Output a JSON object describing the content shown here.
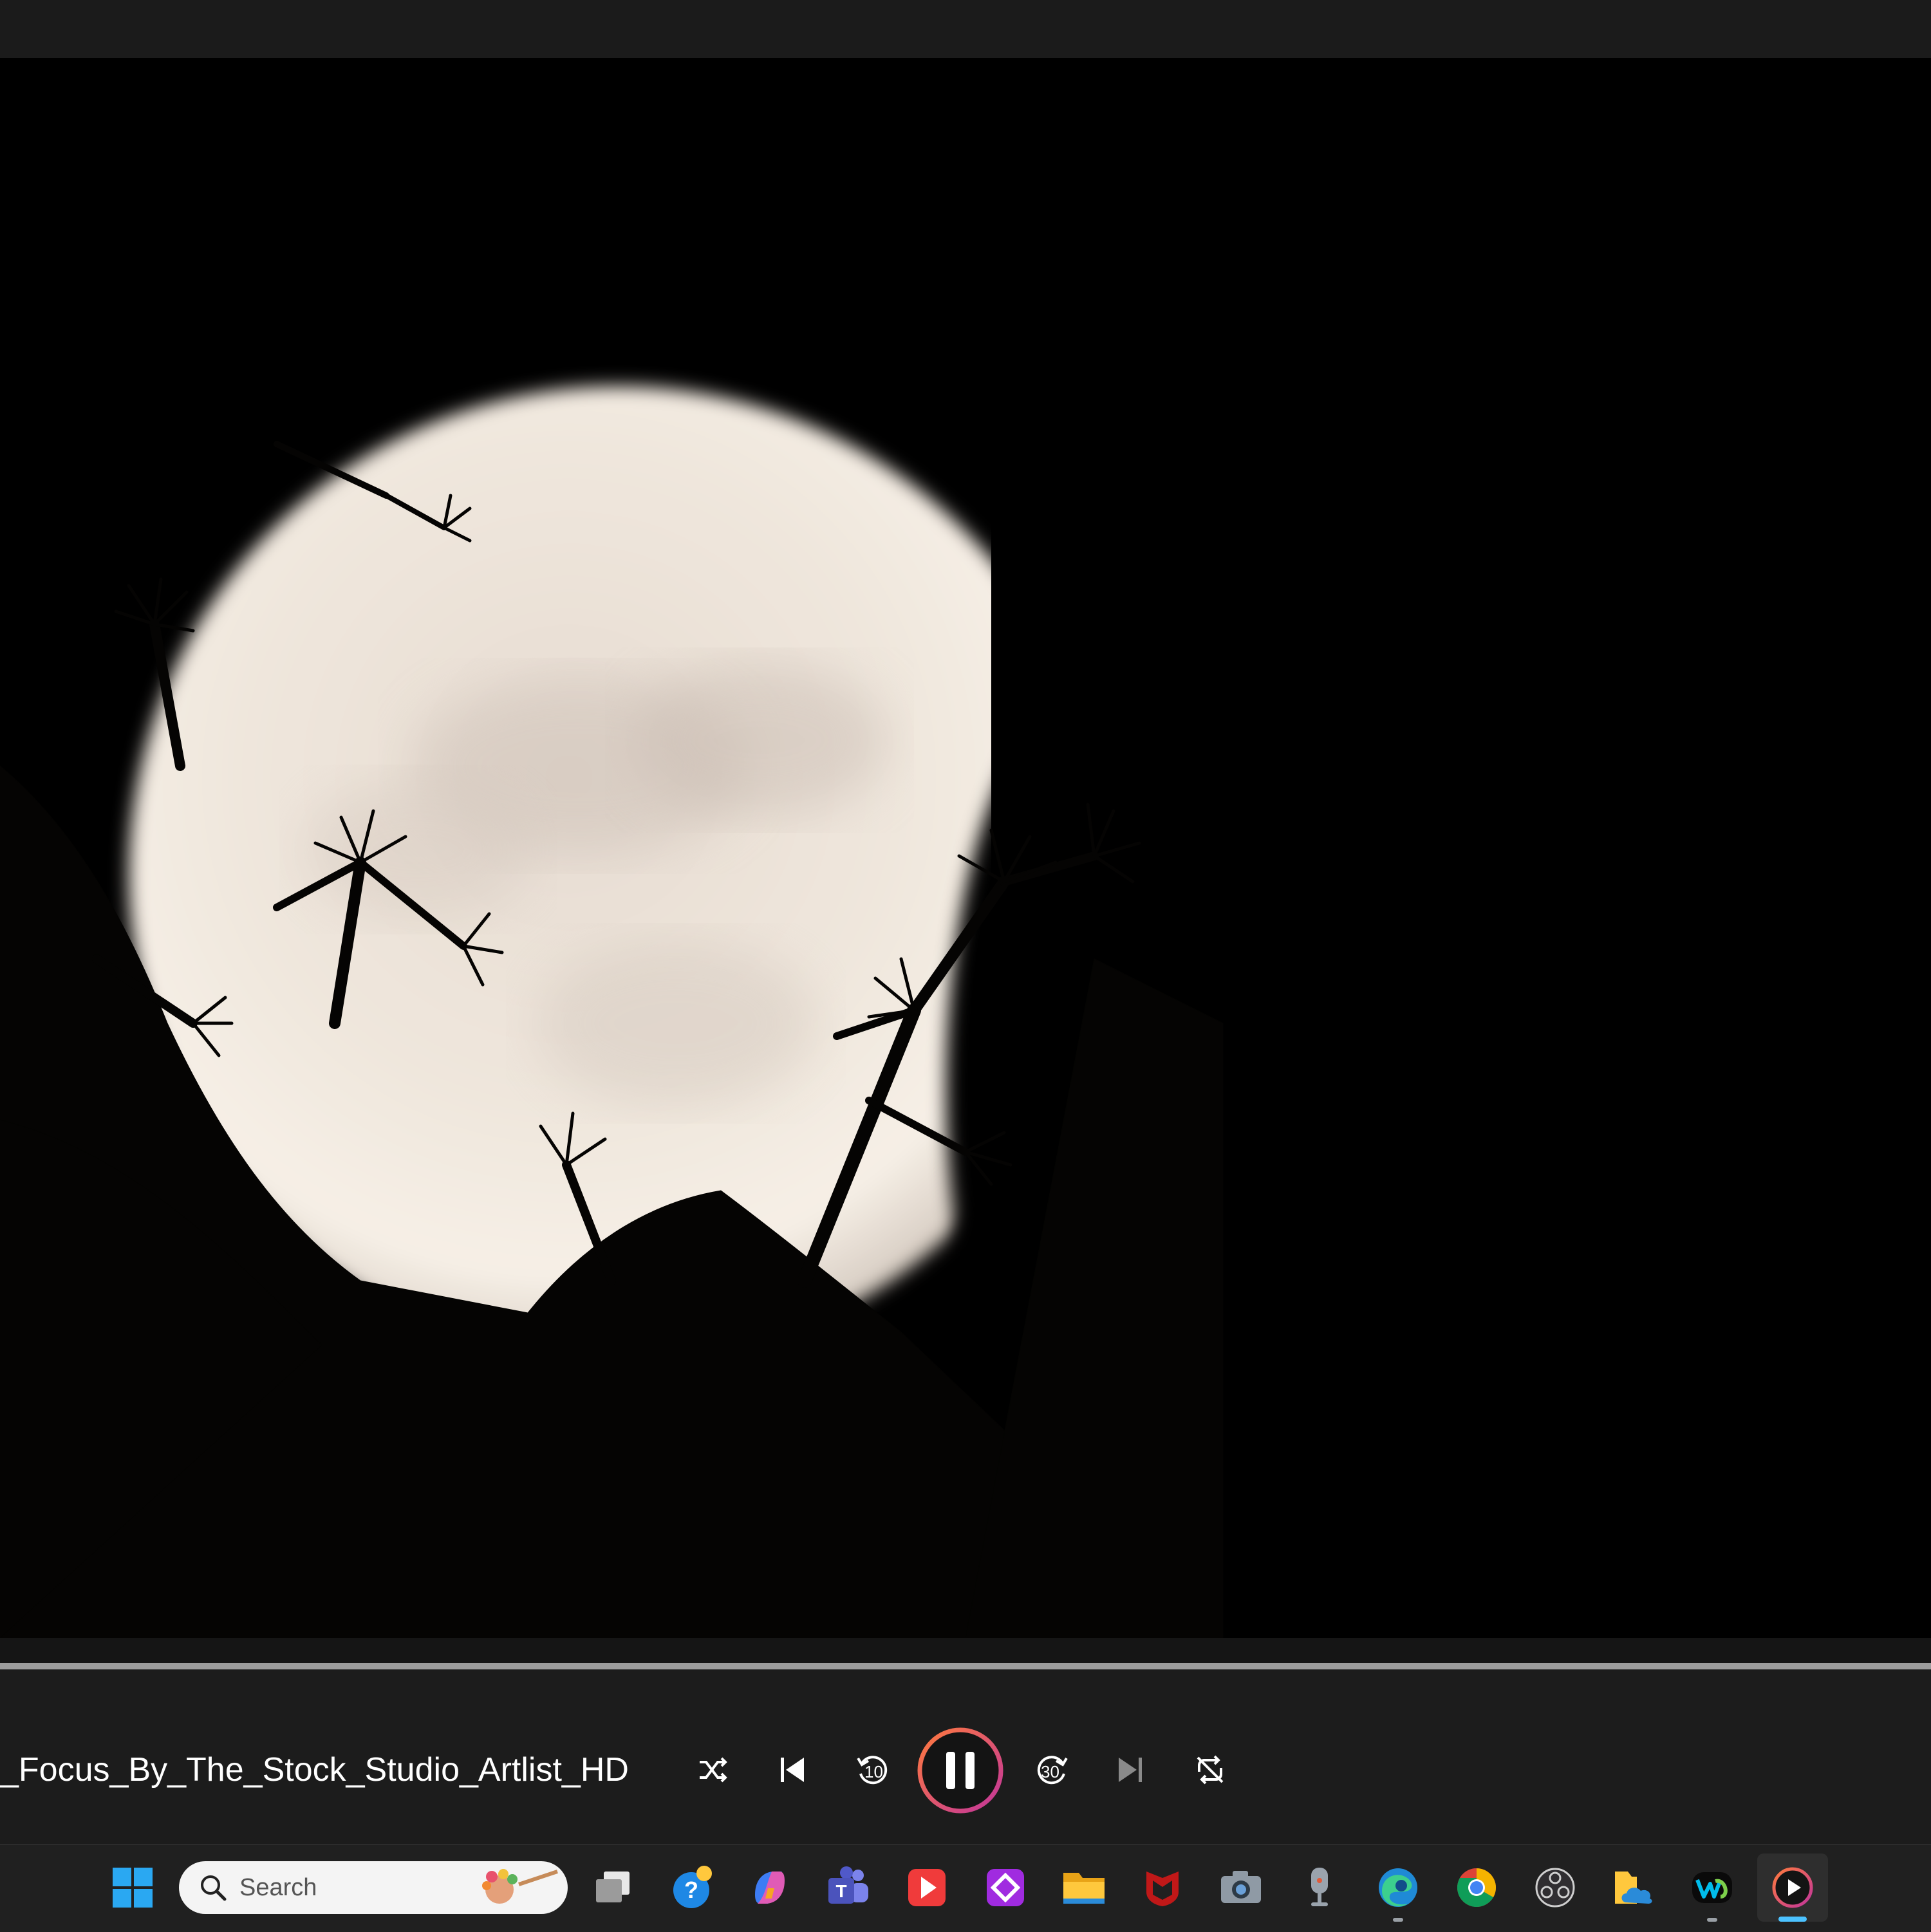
{
  "player": {
    "track_title": "_Focus_By_The_Stock_Studio_Artlist_HD",
    "progress_fraction": 1.0,
    "controls": {
      "shuffle": "shuffle-icon",
      "previous": "previous-icon",
      "rewind": "10",
      "play_pause": "pause-icon",
      "forward": "30",
      "next": "next-icon",
      "repeat": "repeat-off-icon"
    }
  },
  "taskbar": {
    "search_placeholder": "Search",
    "apps": [
      "start",
      "task-view",
      "get-help",
      "copilot",
      "teams",
      "player-red",
      "app-purple",
      "file-explorer",
      "mcafee",
      "camera",
      "microphone",
      "edge",
      "chrome",
      "obs",
      "onedrive-folder",
      "webex",
      "media-player"
    ]
  },
  "colors": {
    "accent_blue": "#4cc2ff",
    "pause_ring_orange": "#ff7a3d",
    "pause_ring_pink": "#c2359b"
  }
}
